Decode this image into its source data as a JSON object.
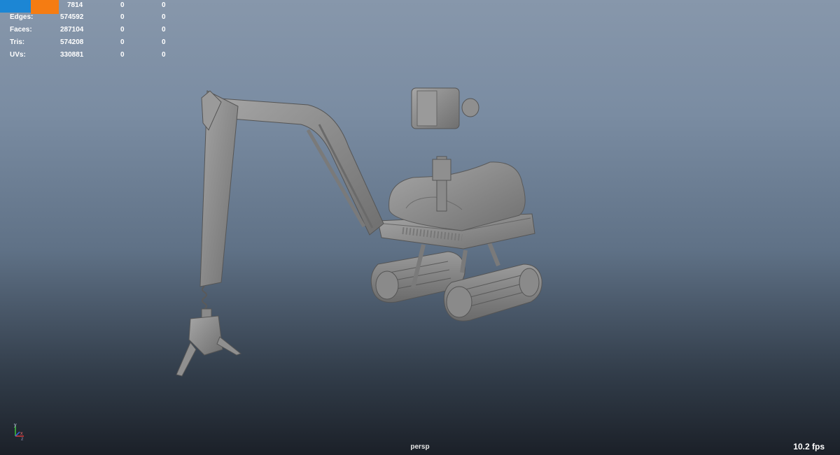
{
  "stats": [
    {
      "label": "",
      "count": "7814",
      "sel": "0",
      "comp": "0"
    },
    {
      "label": "Edges:",
      "count": "574592",
      "sel": "0",
      "comp": "0"
    },
    {
      "label": "Faces:",
      "count": "287104",
      "sel": "0",
      "comp": "0"
    },
    {
      "label": "Tris:",
      "count": "574208",
      "sel": "0",
      "comp": "0"
    },
    {
      "label": "UVs:",
      "count": "330881",
      "sel": "0",
      "comp": "0"
    }
  ],
  "viewport": {
    "camera": "persp",
    "fps": "10.2 fps",
    "axes": {
      "y": "y",
      "x": "x",
      "z": "z"
    }
  },
  "colors": {
    "overlay_blue": "#1c86d4",
    "overlay_orange": "#f57c12",
    "model_gray": "#8e8e8e",
    "axis_x": "#e03c3c",
    "axis_y": "#3cc43c",
    "axis_z": "#3c64e0"
  },
  "model": {
    "type": "mini excavator",
    "shading": "default gray"
  }
}
